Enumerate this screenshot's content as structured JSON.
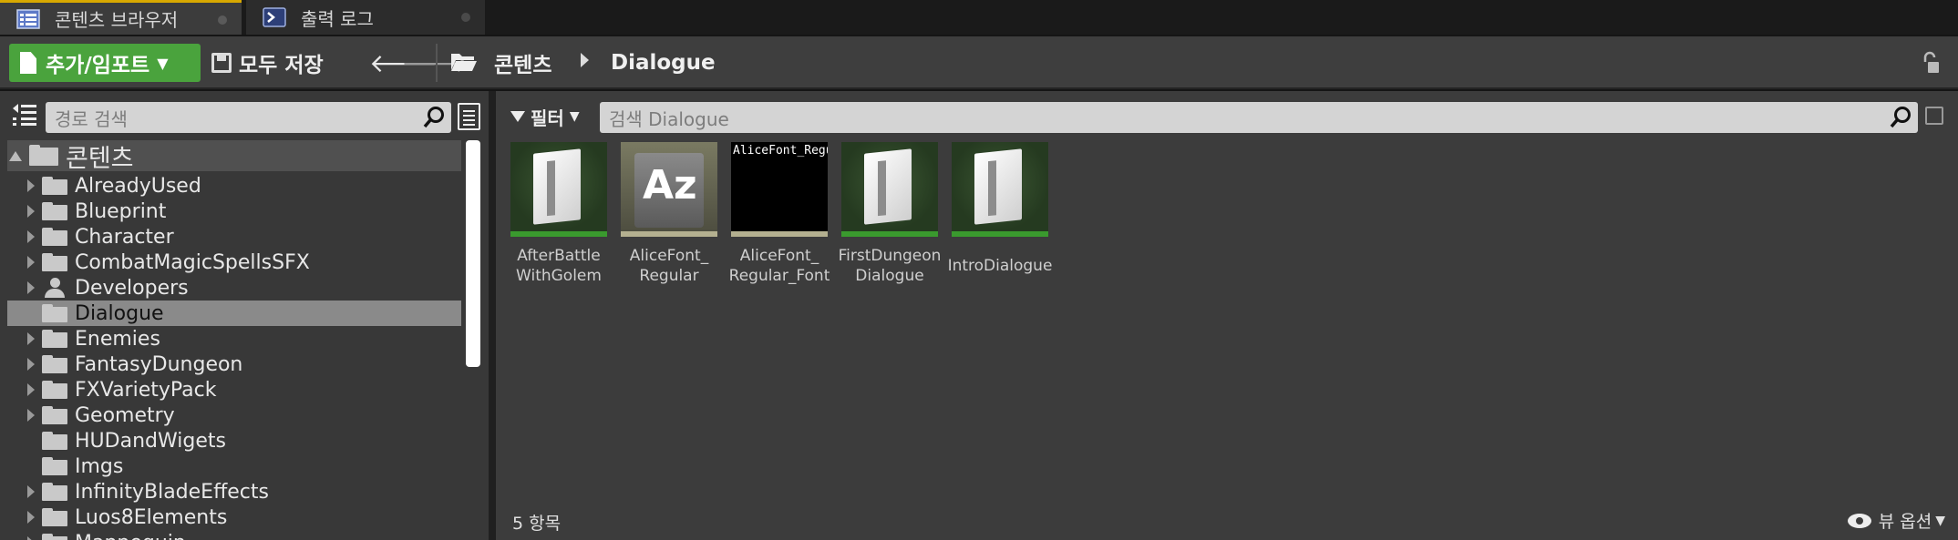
{
  "tabs": [
    {
      "label": "콘텐츠 브라우저",
      "icon": "content-browser-icon",
      "active": true
    },
    {
      "label": "출력 로그",
      "icon": "output-log-icon",
      "active": false
    }
  ],
  "toolbar": {
    "add_import_label": "추가/임포트",
    "save_all_label": "모두 저장",
    "breadcrumb": [
      "콘텐츠",
      "Dialogue"
    ]
  },
  "sources": {
    "search_placeholder": "경로 검색",
    "tree": [
      {
        "label": "콘텐츠",
        "root": true,
        "expandable": true,
        "icon": "folder-icon"
      },
      {
        "label": "AlreadyUsed",
        "expandable": true,
        "icon": "folder-icon"
      },
      {
        "label": "Blueprint",
        "expandable": true,
        "icon": "folder-icon"
      },
      {
        "label": "Character",
        "expandable": true,
        "icon": "folder-icon"
      },
      {
        "label": "CombatMagicSpellsSFX",
        "expandable": true,
        "icon": "folder-icon"
      },
      {
        "label": "Developers",
        "expandable": true,
        "icon": "person-icon"
      },
      {
        "label": "Dialogue",
        "expandable": false,
        "selected": true,
        "icon": "folder-icon"
      },
      {
        "label": "Enemies",
        "expandable": true,
        "icon": "folder-icon"
      },
      {
        "label": "FantasyDungeon",
        "expandable": true,
        "icon": "folder-icon"
      },
      {
        "label": "FXVarietyPack",
        "expandable": true,
        "icon": "folder-icon"
      },
      {
        "label": "Geometry",
        "expandable": true,
        "icon": "folder-icon"
      },
      {
        "label": "HUDandWigets",
        "expandable": false,
        "icon": "folder-icon"
      },
      {
        "label": "Imgs",
        "expandable": false,
        "icon": "folder-icon"
      },
      {
        "label": "InfinityBladeEffects",
        "expandable": true,
        "icon": "folder-icon"
      },
      {
        "label": "Luos8Elements",
        "expandable": true,
        "icon": "folder-icon"
      },
      {
        "label": "Mannequin",
        "expandable": true,
        "icon": "folder-icon"
      }
    ]
  },
  "assets": {
    "filter_label": "필터",
    "search_placeholder": "검색 Dialogue",
    "items": [
      {
        "label_line1": "AfterBattle",
        "label_line2": "WithGolem",
        "kind": "dialogue"
      },
      {
        "label_line1": "AliceFont_",
        "label_line2": "Regular",
        "kind": "font",
        "glyph": "Az"
      },
      {
        "label_line1": "AliceFont_",
        "label_line2": "Regular_Font",
        "kind": "fontface",
        "preview_text": "AliceFont_Regular"
      },
      {
        "label_line1": "FirstDungeon",
        "label_line2": "Dialogue",
        "kind": "dialogue"
      },
      {
        "label_line1": "IntroDialogue",
        "label_line2": "",
        "kind": "dialogue"
      }
    ],
    "item_count": "5 항목",
    "view_options_label": "뷰 옵션"
  },
  "colors": {
    "add_button": "#4aa33d",
    "active_tab_accent": "#d8a800",
    "dialogue_thumb_bar": "#3a9a2e",
    "font_thumb_bar": "#b4b090"
  }
}
